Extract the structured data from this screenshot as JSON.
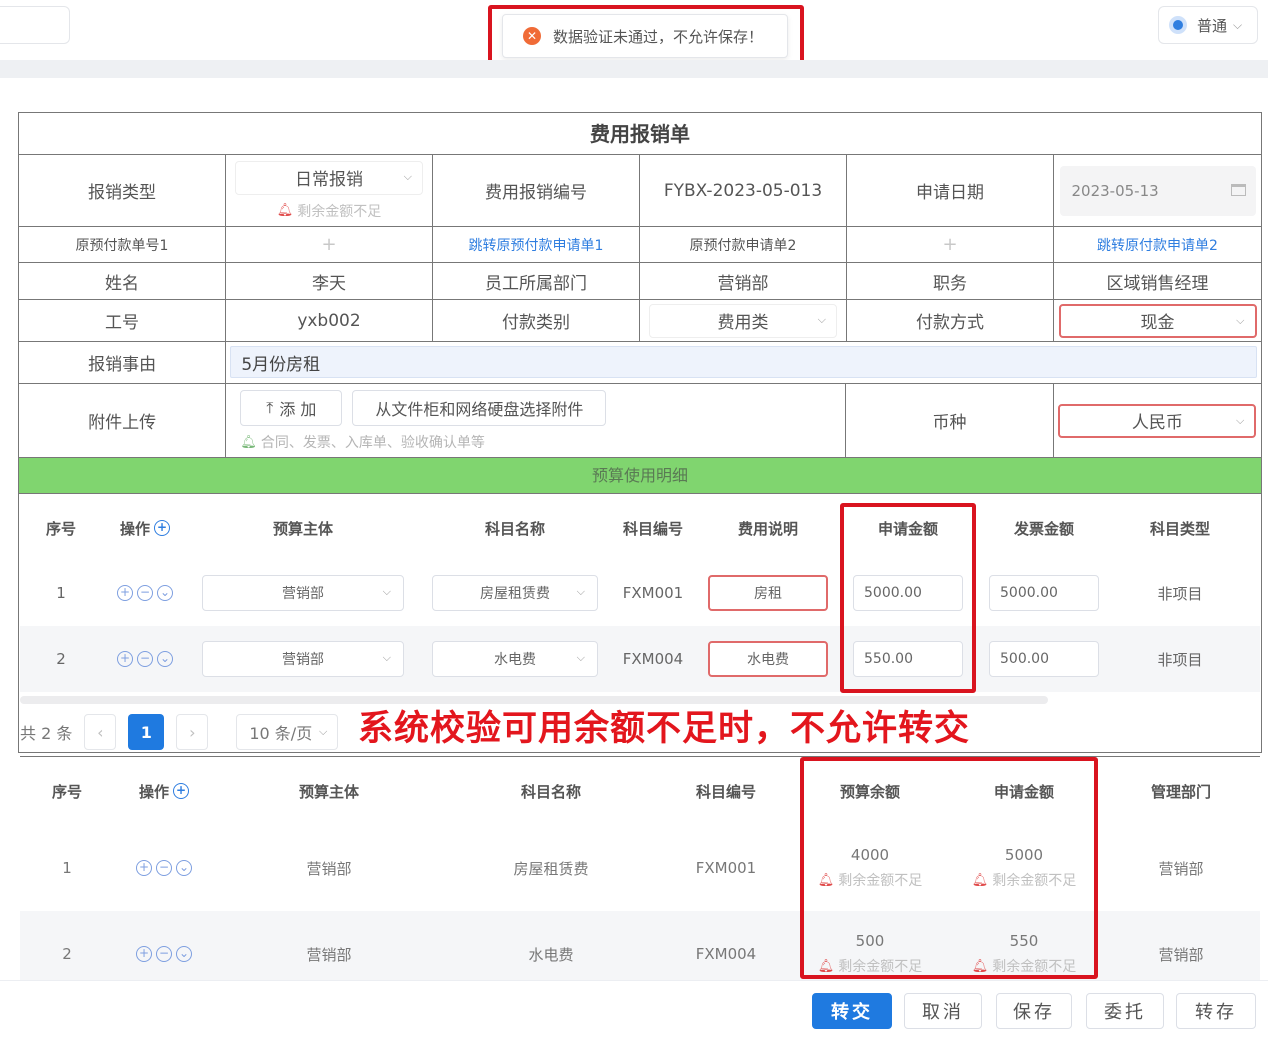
{
  "toast": {
    "message": "数据验证未通过，不允许保存！",
    "icon": "error-circle-icon"
  },
  "mode_select": {
    "value": "普通"
  },
  "form": {
    "title": "费用报销单",
    "reimb_type_label": "报销类型",
    "reimb_type_value": "日常报销",
    "reimb_type_warning": "剩余金额不足",
    "reimb_no_label": "费用报销编号",
    "reimb_no_value": "FYBX-2023-05-013",
    "apply_date_label": "申请日期",
    "apply_date_value": "2023-05-13",
    "prepay1_label": "原预付款单号1",
    "prepay1_link": "跳转原预付款申请单1",
    "prepay2_label": "原预付款申请单2",
    "prepay2_link": "跳转原付款申请单2",
    "name_label": "姓名",
    "name_value": "李天",
    "dept_label": "员工所属部门",
    "dept_value": "营销部",
    "position_label": "职务",
    "position_value": "区域销售经理",
    "empno_label": "工号",
    "empno_value": "yxb002",
    "paytype_label": "付款类别",
    "paytype_value": "费用类",
    "paymethod_label": "付款方式",
    "paymethod_value": "现金",
    "reason_label": "报销事由",
    "reason_value": "5月份房租",
    "attach_label": "附件上传",
    "attach_add": "添 加",
    "attach_pick": "从文件柜和网络硬盘选择附件",
    "attach_hint": "合同、发票、入库单、验收确认单等",
    "currency_label": "币种",
    "currency_value": "人民币",
    "section_title": "预算使用明细"
  },
  "detail_table": {
    "headers": [
      "序号",
      "操作",
      "预算主体",
      "科目名称",
      "科目编号",
      "费用说明",
      "申请金额",
      "发票金额",
      "科目类型"
    ],
    "rows": [
      {
        "no": "1",
        "entity": "营销部",
        "subject": "房屋租赁费",
        "code": "FXM001",
        "desc": "房租",
        "apply": "5000.00",
        "invoice": "5000.00",
        "type": "非项目"
      },
      {
        "no": "2",
        "entity": "营销部",
        "subject": "水电费",
        "code": "FXM004",
        "desc": "水电费",
        "apply": "550.00",
        "invoice": "500.00",
        "type": "非项目"
      }
    ]
  },
  "pager": {
    "total": "共 2 条",
    "prev": "‹",
    "current": "1",
    "next": "›",
    "page_size": "10 条/页"
  },
  "caption": "系统校验可用余额不足时，不允许转交",
  "summary_table": {
    "headers": [
      "序号",
      "操作",
      "预算主体",
      "科目名称",
      "科目编号",
      "预算余额",
      "申请金额",
      "管理部门"
    ],
    "rows": [
      {
        "no": "1",
        "entity": "营销部",
        "subject": "房屋租赁费",
        "code": "FXM001",
        "balance": "4000",
        "balance_warn": "剩余金额不足",
        "apply": "5000",
        "apply_warn": "剩余金额不足",
        "dept": "营销部"
      },
      {
        "no": "2",
        "entity": "营销部",
        "subject": "水电费",
        "code": "FXM004",
        "balance": "500",
        "balance_warn": "剩余金额不足",
        "apply": "550",
        "apply_warn": "剩余金额不足",
        "dept": "营销部"
      }
    ]
  },
  "footer": {
    "transfer": "转交",
    "cancel": "取消",
    "save": "保存",
    "delegate": "委托",
    "save_draft": "转存"
  },
  "colors": {
    "accent": "#1f7ae0",
    "alert_red": "#d9141f",
    "section_green": "#80d56f"
  }
}
